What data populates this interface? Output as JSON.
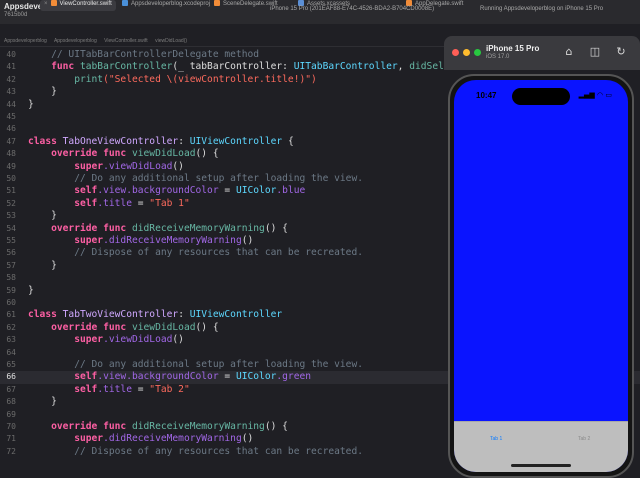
{
  "project": {
    "name": "Appsdeveloperblog",
    "branch": "7615b0d"
  },
  "tabs": [
    {
      "label": "ViewController.swift",
      "active": true
    },
    {
      "label": "Appsdeveloperblog.xcodeproj",
      "active": false
    },
    {
      "label": "SceneDelegate.swift",
      "active": false
    },
    {
      "label": "Assets.xcassets",
      "active": false
    },
    {
      "label": "AppDelegate.swift",
      "active": false
    }
  ],
  "device_chip": "iPhone 15 Pro (201EAF88-E74C-4526-BDA2-B704CD0008E)",
  "run_status": "Running Appsdeveloperblog on iPhone 15 Pro",
  "jumpbar": [
    "Appsdeveloperblog",
    "Appsdeveloperblog",
    "ViewController.swift",
    "viewDidLoad()"
  ],
  "current_line": "66",
  "code_lines": [
    {
      "n": "40",
      "t": "",
      "tokens": [
        [
          "cm",
          "    // UITabBarControllerDelegate method"
        ]
      ]
    },
    {
      "n": "41",
      "tokens": [
        [
          "kw",
          "    func "
        ],
        [
          "fn",
          "tabBarController"
        ],
        [
          "",
          "(_ tabBarController: "
        ],
        [
          "cls",
          "UITabBarController"
        ],
        [
          "",
          ", "
        ],
        [
          "fn",
          "didSelect"
        ],
        [
          "",
          ""
        ]
      ]
    },
    {
      "n": "42",
      "tokens": [
        [
          "fn",
          "        print"
        ],
        [
          "",
          ""
        ],
        [
          "str",
          "(\"Selected \\(viewController.title!)\")"
        ]
      ]
    },
    {
      "n": "43",
      "tokens": [
        [
          "",
          "    }"
        ]
      ]
    },
    {
      "n": "44",
      "tokens": [
        [
          "",
          "}"
        ]
      ]
    },
    {
      "n": "45",
      "tokens": [
        [
          "",
          ""
        ]
      ]
    },
    {
      "n": "46",
      "tokens": [
        [
          "",
          ""
        ]
      ]
    },
    {
      "n": "47",
      "tokens": [
        [
          "kw",
          "class "
        ],
        [
          "ty",
          "TabOneViewController"
        ],
        [
          "",
          ": "
        ],
        [
          "cls",
          "UIViewController"
        ],
        [
          "",
          " {"
        ]
      ]
    },
    {
      "n": "48",
      "tokens": [
        [
          "kw",
          "    override func "
        ],
        [
          "fn",
          "viewDidLoad"
        ],
        [
          "",
          "() {"
        ]
      ]
    },
    {
      "n": "49",
      "tokens": [
        [
          "kw",
          "        super"
        ],
        [
          "",
          ""
        ],
        [
          "prop",
          ".viewDidLoad"
        ],
        [
          "",
          "()"
        ]
      ]
    },
    {
      "n": "50",
      "tokens": [
        [
          "cm",
          "        // Do any additional setup after loading the view."
        ]
      ]
    },
    {
      "n": "51",
      "tokens": [
        [
          "kw",
          "        self"
        ],
        [
          "prop",
          ".view.backgroundColor"
        ],
        [
          "",
          " = "
        ],
        [
          "cls",
          "UIColor"
        ],
        [
          "prop",
          ".blue"
        ]
      ]
    },
    {
      "n": "52",
      "tokens": [
        [
          "kw",
          "        self"
        ],
        [
          "prop",
          ".title"
        ],
        [
          "",
          " = "
        ],
        [
          "str",
          "\"Tab 1\""
        ]
      ]
    },
    {
      "n": "53",
      "tokens": [
        [
          "",
          "    }"
        ]
      ]
    },
    {
      "n": "54",
      "tokens": [
        [
          "kw",
          "    override func "
        ],
        [
          "fn",
          "didReceiveMemoryWarning"
        ],
        [
          "",
          "() {"
        ]
      ]
    },
    {
      "n": "55",
      "tokens": [
        [
          "kw",
          "        super"
        ],
        [
          "prop",
          ".didReceiveMemoryWarning"
        ],
        [
          "",
          "()"
        ]
      ]
    },
    {
      "n": "56",
      "tokens": [
        [
          "cm",
          "        // Dispose of any resources that can be recreated."
        ]
      ]
    },
    {
      "n": "57",
      "tokens": [
        [
          "",
          "    }"
        ]
      ]
    },
    {
      "n": "58",
      "tokens": [
        [
          "",
          ""
        ]
      ]
    },
    {
      "n": "59",
      "tokens": [
        [
          "",
          "}"
        ]
      ]
    },
    {
      "n": "60",
      "tokens": [
        [
          "",
          ""
        ]
      ]
    },
    {
      "n": "61",
      "tokens": [
        [
          "kw",
          "class "
        ],
        [
          "ty",
          "TabTwoViewController"
        ],
        [
          "",
          ": "
        ],
        [
          "cls",
          "UIViewController"
        ],
        [
          "",
          ""
        ]
      ]
    },
    {
      "n": "62",
      "tokens": [
        [
          "kw",
          "    override func "
        ],
        [
          "fn",
          "viewDidLoad"
        ],
        [
          "",
          "() {"
        ]
      ]
    },
    {
      "n": "63",
      "tokens": [
        [
          "kw",
          "        super"
        ],
        [
          "prop",
          ".viewDidLoad"
        ],
        [
          "",
          "()"
        ]
      ]
    },
    {
      "n": "64",
      "tokens": [
        [
          "",
          ""
        ]
      ]
    },
    {
      "n": "65",
      "tokens": [
        [
          "cm",
          "        // Do any additional setup after loading the view."
        ]
      ]
    },
    {
      "n": "66",
      "tokens": [
        [
          "kw",
          "        self"
        ],
        [
          "prop",
          ".view.backgroundColor"
        ],
        [
          "",
          " = "
        ],
        [
          "cls",
          "UIColor"
        ],
        [
          "prop",
          ".green"
        ]
      ]
    },
    {
      "n": "67",
      "tokens": [
        [
          "kw",
          "        self"
        ],
        [
          "prop",
          ".title"
        ],
        [
          "",
          " = "
        ],
        [
          "str",
          "\"Tab 2\""
        ]
      ]
    },
    {
      "n": "68",
      "tokens": [
        [
          "",
          "    }"
        ]
      ]
    },
    {
      "n": "69",
      "tokens": [
        [
          "",
          ""
        ]
      ]
    },
    {
      "n": "70",
      "tokens": [
        [
          "kw",
          "    override func "
        ],
        [
          "fn",
          "didReceiveMemoryWarning"
        ],
        [
          "",
          "() {"
        ]
      ]
    },
    {
      "n": "71",
      "tokens": [
        [
          "kw",
          "        super"
        ],
        [
          "prop",
          ".didReceiveMemoryWarning"
        ],
        [
          "",
          "()"
        ]
      ]
    },
    {
      "n": "72",
      "tokens": [
        [
          "cm",
          "        // Dispose of any resources that can be recreated."
        ]
      ]
    }
  ],
  "simulator": {
    "device_name": "iPhone 15 Pro",
    "os_version": "iOS 17.0",
    "time": "10:47",
    "screen_color": "#0a14ff",
    "tab_bar": {
      "items": [
        {
          "label": "Tab 1",
          "selected": true
        },
        {
          "label": "Tab 2",
          "selected": false
        }
      ],
      "selected_color": "#0a7aff",
      "unselected_color": "#8a8a8a"
    },
    "toolbar_icons": [
      "home-icon",
      "screenshot-icon",
      "rotate-icon"
    ]
  }
}
